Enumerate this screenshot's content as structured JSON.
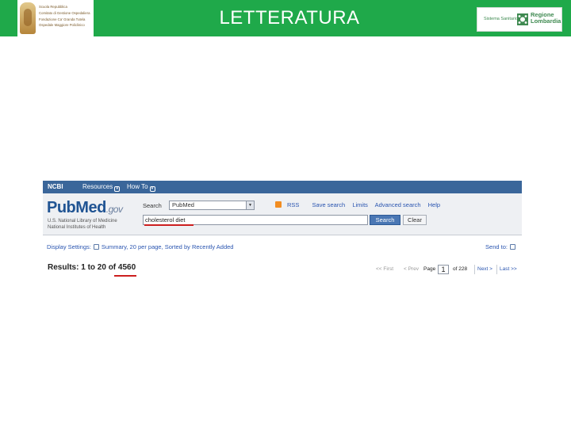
{
  "slide": {
    "title": "LETTERATURA",
    "left_logo_lines": [
      "Scuola Repubblica",
      "Comitato di Gestione Ospedaliera",
      "Fondazione Ca' Granda Tutela",
      "Ospedale Maggiore Policlinico"
    ],
    "right_logo": {
      "tagline": "Sistema Sanitario",
      "name_line1": "Regione",
      "name_line2": "Lombardia"
    }
  },
  "pubmed": {
    "ncbi_bar": {
      "brand": "NCBI",
      "resources": "Resources",
      "how_to": "How To"
    },
    "logo": {
      "pub": "Pub",
      "med": "Med",
      "gov": ".gov"
    },
    "subtitle_lines": [
      "U.S. National Library of Medicine",
      "National Institutes of Health"
    ],
    "search": {
      "label": "Search",
      "database": "PubMed",
      "query": "cholesterol diet",
      "search_button": "Search",
      "clear_button": "Clear"
    },
    "links": {
      "rss": "RSS",
      "save_search": "Save search",
      "limits": "Limits",
      "advanced_search": "Advanced search",
      "help": "Help"
    },
    "display": {
      "display_settings": "Display Settings:",
      "settings_value": "Summary, 20 per page, Sorted by Recently Added",
      "send_to": "Send to:"
    },
    "results": {
      "prefix": "Results: 1 to 20 of",
      "count": "4560"
    },
    "pager": {
      "first": "<< First",
      "prev": "< Prev",
      "page_label": "Page",
      "page_value": "1",
      "of_total": "of 228",
      "next": "Next >",
      "last": "Last >>"
    }
  }
}
